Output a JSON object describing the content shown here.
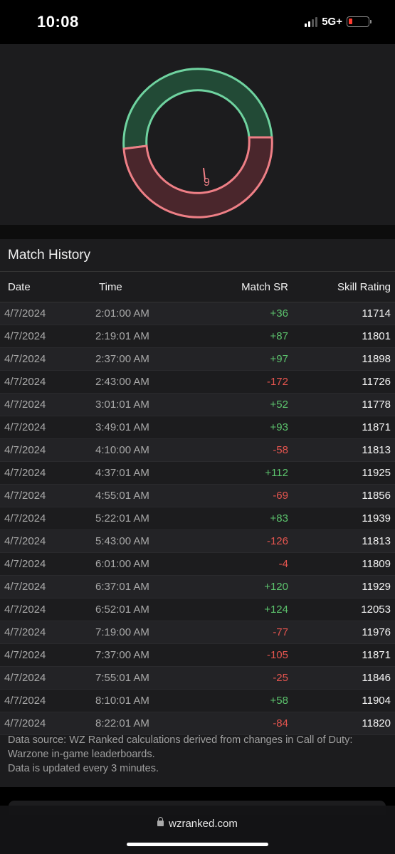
{
  "status": {
    "time": "10:08",
    "network": "5G+"
  },
  "chart": {
    "loss_label": "9"
  },
  "history": {
    "title": "Match History",
    "headers": {
      "date": "Date",
      "time": "Time",
      "match_sr": "Match SR",
      "skill": "Skill Rating"
    },
    "rows": [
      {
        "date": "4/7/2024",
        "time": "2:01:00 AM",
        "sr": "+36",
        "skill": "11714"
      },
      {
        "date": "4/7/2024",
        "time": "2:19:01 AM",
        "sr": "+87",
        "skill": "11801"
      },
      {
        "date": "4/7/2024",
        "time": "2:37:00 AM",
        "sr": "+97",
        "skill": "11898"
      },
      {
        "date": "4/7/2024",
        "time": "2:43:00 AM",
        "sr": "-172",
        "skill": "11726"
      },
      {
        "date": "4/7/2024",
        "time": "3:01:01 AM",
        "sr": "+52",
        "skill": "11778"
      },
      {
        "date": "4/7/2024",
        "time": "3:49:01 AM",
        "sr": "+93",
        "skill": "11871"
      },
      {
        "date": "4/7/2024",
        "time": "4:10:00 AM",
        "sr": "-58",
        "skill": "11813"
      },
      {
        "date": "4/7/2024",
        "time": "4:37:01 AM",
        "sr": "+112",
        "skill": "11925"
      },
      {
        "date": "4/7/2024",
        "time": "4:55:01 AM",
        "sr": "-69",
        "skill": "11856"
      },
      {
        "date": "4/7/2024",
        "time": "5:22:01 AM",
        "sr": "+83",
        "skill": "11939"
      },
      {
        "date": "4/7/2024",
        "time": "5:43:00 AM",
        "sr": "-126",
        "skill": "11813"
      },
      {
        "date": "4/7/2024",
        "time": "6:01:00 AM",
        "sr": "-4",
        "skill": "11809"
      },
      {
        "date": "4/7/2024",
        "time": "6:37:01 AM",
        "sr": "+120",
        "skill": "11929"
      },
      {
        "date": "4/7/2024",
        "time": "6:52:01 AM",
        "sr": "+124",
        "skill": "12053"
      },
      {
        "date": "4/7/2024",
        "time": "7:19:00 AM",
        "sr": "-77",
        "skill": "11976"
      },
      {
        "date": "4/7/2024",
        "time": "7:37:00 AM",
        "sr": "-105",
        "skill": "11871"
      },
      {
        "date": "4/7/2024",
        "time": "7:55:01 AM",
        "sr": "-25",
        "skill": "11846"
      },
      {
        "date": "4/7/2024",
        "time": "8:10:01 AM",
        "sr": "+58",
        "skill": "11904"
      },
      {
        "date": "4/7/2024",
        "time": "8:22:01 AM",
        "sr": "-84",
        "skill": "11820"
      }
    ],
    "footnote_line1": "Data source: WZ Ranked calculations derived from changes in Call of Duty: Warzone in-game leaderboards.",
    "footnote_line2": "Data is updated every 3 minutes."
  },
  "browser": {
    "url": "wzranked.com"
  },
  "colors": {
    "positive": "#5cc36d",
    "negative": "#e5554f",
    "win_stroke": "#6fd3a0",
    "loss_stroke": "#ee7f86"
  }
}
